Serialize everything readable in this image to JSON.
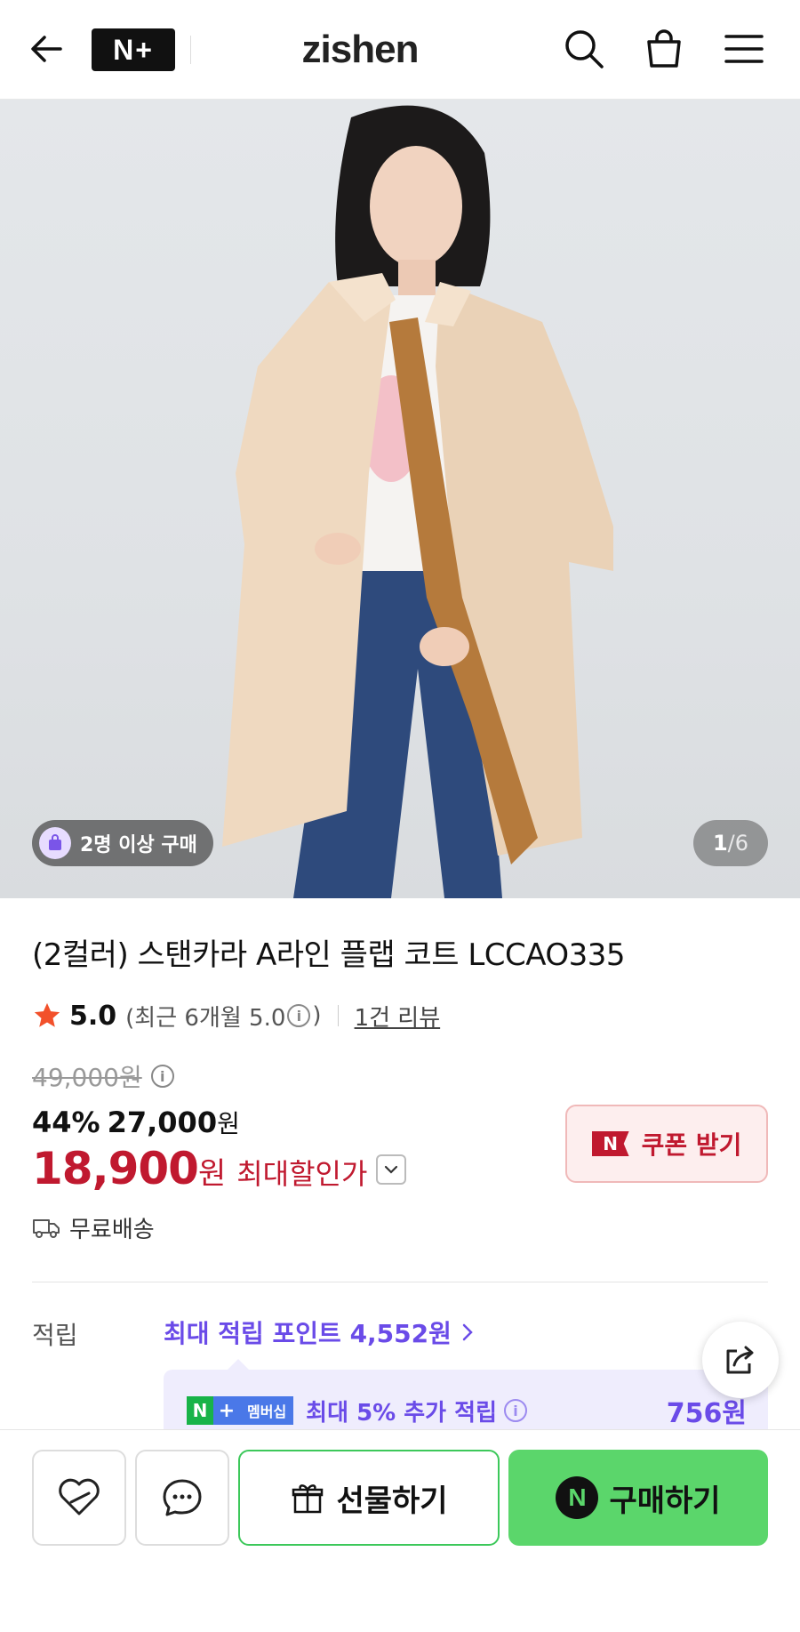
{
  "header": {
    "back_icon": "arrow-left-icon",
    "nplus_label": "N+",
    "brand": "zishen",
    "icons": [
      "search-icon",
      "shopping-bag-icon",
      "menu-icon"
    ]
  },
  "hero": {
    "group_buy_badge": "2명 이상 구매",
    "counter_current": "1",
    "counter_sep": "/",
    "counter_total": "6"
  },
  "product": {
    "title": "(2컬러) 스탠카라 A라인 플랩 코트 LCCAO335",
    "rating_score": "5.0",
    "rating_recent": "(최근 6개월 5.0",
    "rating_recent_close": ")",
    "review_link": "1건 리뷰",
    "original_price": "49,000원",
    "discount_percent": "44%",
    "discount_price": "27,000",
    "discount_won": "원",
    "final_price": "18,900",
    "final_won": "원",
    "final_label": "최대할인가",
    "coupon_badge": "N",
    "coupon_button": "쿠폰 받기",
    "shipping": "무료배송"
  },
  "points": {
    "label": "적립",
    "max_points": "최대 적립 포인트 4,552원",
    "member_n": "N",
    "member_plus": "+",
    "member_tag": "멤버십",
    "member_text": "최대 5% 추가 적립",
    "member_amount": "756원"
  },
  "bottom_bar": {
    "gift_label": "선물하기",
    "buy_badge": "N",
    "buy_label": "구매하기"
  },
  "colors": {
    "accent_red": "#c0192f",
    "accent_purple": "#6a4be8",
    "naver_green": "#5bd66b"
  }
}
